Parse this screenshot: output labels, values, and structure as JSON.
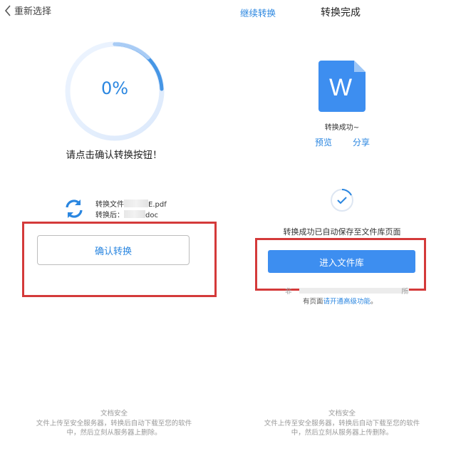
{
  "left": {
    "back_label": "重新选择",
    "progress_text": "0%",
    "progress_value": 0,
    "prompt": "请点击确认转换按钮！",
    "file_before_prefix": "转换文件",
    "file_before_suffix": "E.pdf",
    "file_after_prefix": "转换后：",
    "file_after_suffix": "doc",
    "confirm_label": "确认转换",
    "security_title": "文档安全",
    "security_line1": "文件上传至安全服务器，转换后自动下载至您的软件",
    "security_line2": "中，然后立刻从服务器上删除。"
  },
  "right": {
    "continue_label": "继续转换",
    "title": "转换完成",
    "doc_letter": "W",
    "success_text": "转换成功~",
    "preview_label": "预览",
    "share_label": "分享",
    "saved_text": "转换成功已自动保存至文件库页面",
    "enter_label": "进入文件库",
    "note_prefix": "非",
    "note_suffix": "所",
    "note_line2_prefix": "有页面",
    "note_link": "请开通高级功能",
    "note_line2_suffix": "。",
    "security_title": "文档安全",
    "security_line1": "文件上传至安全服务器，转换后自动下载至您的软件",
    "security_line2": "中，然后立刻从服务器上传删除。"
  },
  "colors": {
    "accent": "#2a86e0",
    "button_blue": "#3d8ef0",
    "highlight_red": "#d43a3a",
    "doc_blue": "#3d8ef0"
  },
  "icons": {
    "back": "chevron-left-icon",
    "sync": "sync-arrows-icon",
    "document": "word-document-icon",
    "check": "check-circle-icon"
  }
}
